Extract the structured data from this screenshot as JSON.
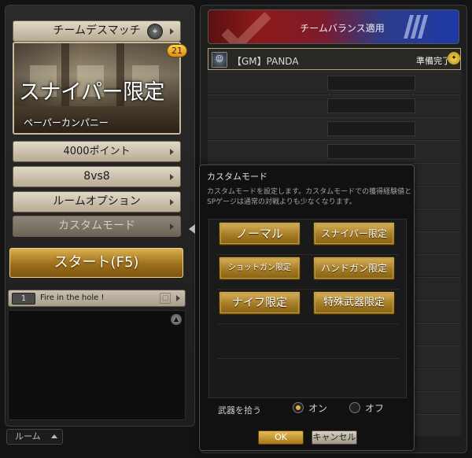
{
  "left": {
    "game_mode": "チームデスマッチ",
    "game_mode_icon": "crosshair-icon",
    "map": {
      "title": "スナイパー限定",
      "name": "ペーパーカンパニー",
      "badge": "21"
    },
    "points": "4000ポイント",
    "team_size": "8vs8",
    "room_options": "ルームオプション",
    "custom_mode": "カスタムモード",
    "start": "スタート(F5)",
    "chat": {
      "channel": "1",
      "message": "Fire in the hole !"
    },
    "room_tab": "ルーム"
  },
  "right": {
    "team_balance": "チームバランス適用",
    "player": {
      "name": "【GM】PANDA",
      "status": "準備完了"
    }
  },
  "popup": {
    "title": "カスタムモード",
    "description": "カスタムモードを設定します。カスタムモードでの獲得経験値とSPゲージは通常の対戦よりも少なくなります。",
    "modes": [
      "ノーマル",
      "スナイパー限定",
      "ショットガン限定",
      "ハンドガン限定",
      "ナイフ限定",
      "特殊武器限定"
    ],
    "weapon_pickup": {
      "label": "武器を拾う",
      "on": "オン",
      "off": "オフ",
      "selected": "オン"
    },
    "ok": "OK",
    "cancel": "キャンセル"
  },
  "colors": {
    "gold_accent": "#d8b35a",
    "tan_bar": "#c9bfae",
    "red_team": "#8d1a1a",
    "blue_team": "#1d3aa8"
  }
}
